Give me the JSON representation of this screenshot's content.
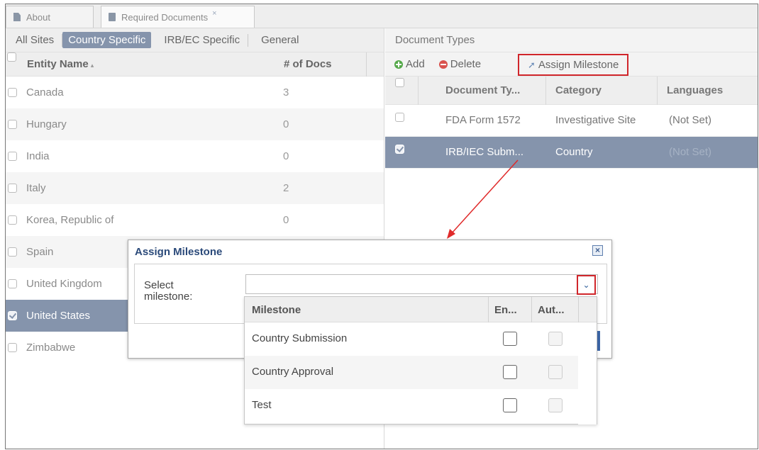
{
  "tabs": [
    {
      "label": "About"
    },
    {
      "label": "Required Documents",
      "close": "×"
    }
  ],
  "left_pane": {
    "subtabs": [
      {
        "label": "All Sites"
      },
      {
        "label": "Country Specific",
        "selected": true
      },
      {
        "label": "IRB/EC Specific"
      },
      {
        "label": "General"
      }
    ],
    "columns": {
      "entity": "Entity Name",
      "sort_indicator": "▴",
      "docs": "# of Docs"
    },
    "rows": [
      {
        "name": "Canada",
        "docs": "3"
      },
      {
        "name": "Hungary",
        "docs": "0"
      },
      {
        "name": "India",
        "docs": "0"
      },
      {
        "name": "Italy",
        "docs": "2"
      },
      {
        "name": "Korea, Republic of",
        "docs": "0"
      },
      {
        "name": "Spain",
        "docs": ""
      },
      {
        "name": "United Kingdom",
        "docs": ""
      },
      {
        "name": "United States",
        "docs": "",
        "selected": true
      },
      {
        "name": "Zimbabwe",
        "docs": ""
      }
    ]
  },
  "right_pane": {
    "title": "Document Types",
    "toolbar": {
      "add": "Add",
      "delete": "Delete",
      "assign": "Assign Milestone"
    },
    "columns": {
      "doc_type": "Document Ty...",
      "category": "Category",
      "languages": "Languages"
    },
    "rows": [
      {
        "doc_type": "FDA Form 1572",
        "category": "Investigative Site",
        "languages": "(Not Set)"
      },
      {
        "doc_type": "IRB/IEC Subm...",
        "category": "Country",
        "languages": "(Not Set)",
        "selected": true
      }
    ]
  },
  "dialog": {
    "title": "Assign Milestone",
    "close": "×",
    "select_label": "Select milestone:",
    "select_value": "",
    "dropdown_glyph": "⌄",
    "list": {
      "columns": {
        "milestone": "Milestone",
        "en": "En...",
        "aut": "Aut..."
      },
      "rows": [
        {
          "milestone": "Country Submission"
        },
        {
          "milestone": "Country Approval"
        },
        {
          "milestone": "Test"
        }
      ]
    }
  },
  "colors": {
    "selection": "#8594ac",
    "highlight": "#d0262b",
    "title_blue": "#2b4a7a"
  }
}
